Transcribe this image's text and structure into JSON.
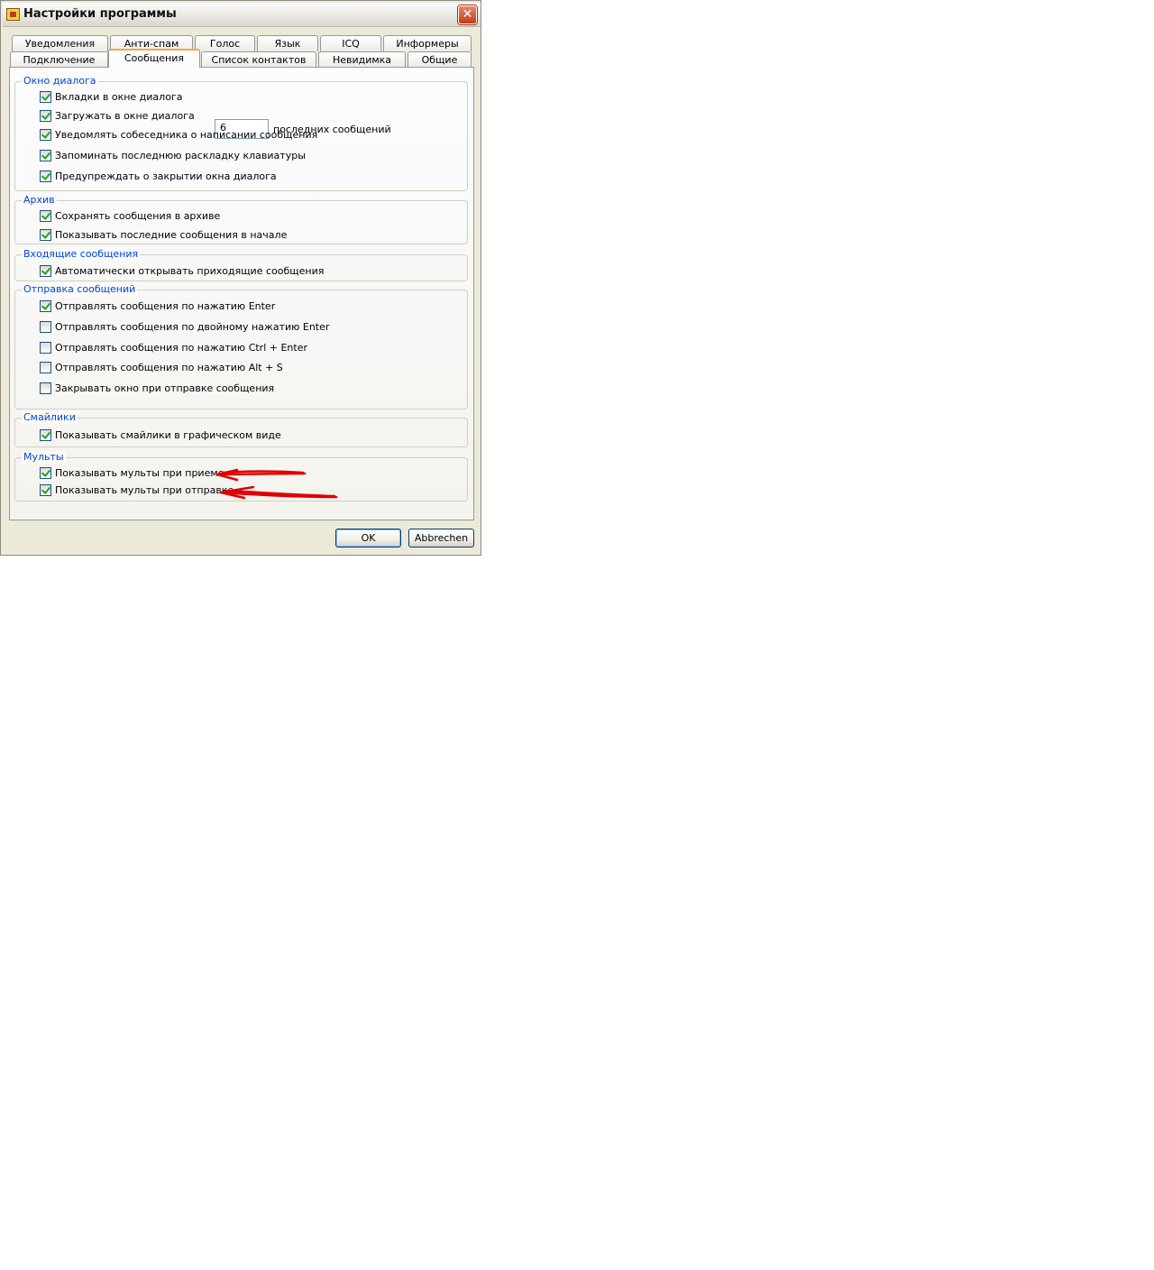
{
  "window": {
    "title": "Настройки программы",
    "close_glyph": "✕",
    "icon": "app-icon"
  },
  "tabs": {
    "row1": [
      "Уведомления",
      "Анти-спам",
      "Голос",
      "Язык",
      "ICQ",
      "Информеры"
    ],
    "row2": [
      "Подключение",
      "Сообщения",
      "Список контактов",
      "Невидимка",
      "Общие"
    ],
    "active": "Сообщения"
  },
  "groups": {
    "dialog": {
      "title": "Окно диалога",
      "items": [
        {
          "label": "Вкладки в окне диалога",
          "checked": true
        },
        {
          "label": "Загружать в окне диалога",
          "checked": true
        },
        {
          "label": "Уведомлять собеседника о написании сообщения",
          "checked": true
        },
        {
          "label": "Запоминать последнюю раскладку клавиатуры",
          "checked": true
        },
        {
          "label": "Предупреждать о закрытии окна диалога",
          "checked": true
        }
      ],
      "history_count": "6",
      "history_suffix": "последних сообщений"
    },
    "archive": {
      "title": "Архив",
      "items": [
        {
          "label": "Сохранять сообщения в архиве",
          "checked": true
        },
        {
          "label": "Показывать последние сообщения в начале",
          "checked": true
        }
      ]
    },
    "incoming": {
      "title": "Входящие сообщения",
      "items": [
        {
          "label": "Автоматически открывать приходящие сообщения",
          "checked": true
        }
      ]
    },
    "sending": {
      "title": "Отправка сообщений",
      "items": [
        {
          "label": "Отправлять сообщения по нажатию Enter",
          "checked": true
        },
        {
          "label": "Отправлять сообщения по двойному нажатию Enter",
          "checked": false
        },
        {
          "label": "Отправлять сообщения по нажатию Ctrl + Enter",
          "checked": false
        },
        {
          "label": "Отправлять сообщения по нажатию Alt + S",
          "checked": false
        },
        {
          "label": "Закрывать окно при отправке сообщения",
          "checked": false
        }
      ]
    },
    "smileys": {
      "title": "Смайлики",
      "items": [
        {
          "label": "Показывать смайлики в графическом виде",
          "checked": true
        }
      ]
    },
    "multi": {
      "title": "Мульты",
      "items": [
        {
          "label": "Показывать мульты при приеме",
          "checked": true
        },
        {
          "label": "Показывать мульты при отправке",
          "checked": true
        }
      ]
    }
  },
  "buttons": {
    "ok": "OK",
    "cancel": "Abbrechen"
  },
  "annotation_color": "#e00000"
}
